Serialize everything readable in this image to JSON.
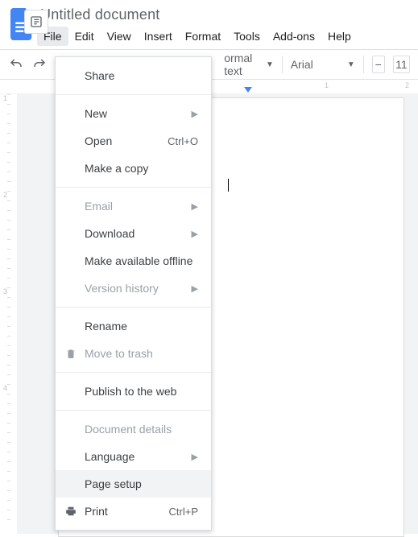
{
  "header": {
    "doc_title": "Untitled document",
    "menus": [
      "File",
      "Edit",
      "View",
      "Insert",
      "Format",
      "Tools",
      "Add-ons",
      "Help"
    ]
  },
  "toolbar": {
    "style_label": "ormal text",
    "font_label": "Arial",
    "font_size": "11",
    "minus": "−"
  },
  "ruler": {
    "labels": [
      "1",
      "2"
    ]
  },
  "left_ruler": {
    "labels": [
      "1",
      "2",
      "3",
      "4"
    ]
  },
  "dropdown": {
    "share": "Share",
    "new": "New",
    "open": "Open",
    "open_sc": "Ctrl+O",
    "copy": "Make a copy",
    "email": "Email",
    "download": "Download",
    "offline": "Make available offline",
    "version": "Version history",
    "rename": "Rename",
    "trash": "Move to trash",
    "publish": "Publish to the web",
    "details": "Document details",
    "language": "Language",
    "pagesetup": "Page setup",
    "print": "Print",
    "print_sc": "Ctrl+P"
  }
}
